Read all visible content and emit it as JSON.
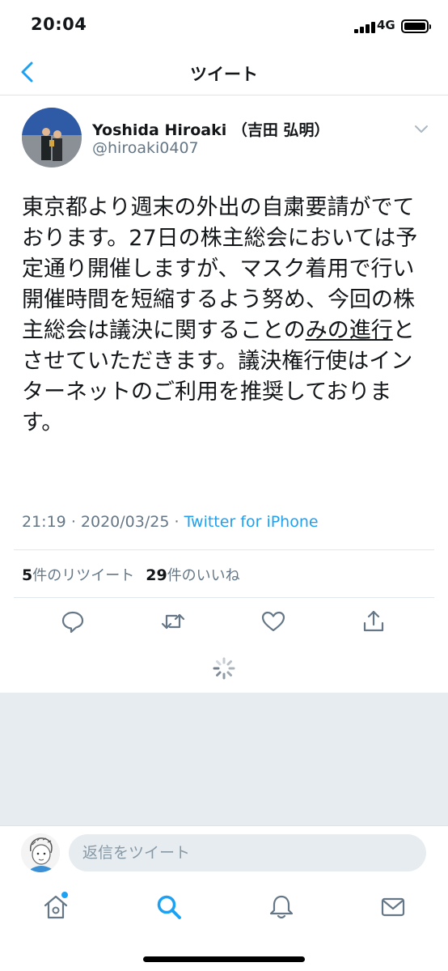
{
  "status_bar": {
    "time": "20:04",
    "network": "4G"
  },
  "nav": {
    "title": "ツイート"
  },
  "tweet": {
    "author_name": "Yoshida Hiroaki （吉田 弘明）",
    "author_handle": "@hiroaki0407",
    "text_before": "東京都より週末の外出の自粛要請がでております。27日の株主総会においては予定通り開催しますが、マスク着用で行い開催時間を短縮するよう努め、今回の株主総会は議決に関することの",
    "text_underlined": "みの進行",
    "text_after": "とさせていただきます。議決権行使はインターネットのご利用を推奨しております。",
    "time": "21:19",
    "separator": "·",
    "date": "2020/03/25",
    "source": "Twitter for iPhone"
  },
  "stats": {
    "retweet_count": "5",
    "retweet_label": "件のリツイート",
    "like_count": "29",
    "like_label": "件のいいね"
  },
  "reply": {
    "placeholder": "返信をツイート"
  },
  "colors": {
    "accent": "#1da1f2",
    "muted": "#657786",
    "divider": "#e1e8ed",
    "gray_bg": "#e6ecf0"
  },
  "icons": {
    "back": "chevron-left-icon",
    "caret": "chevron-down-icon",
    "reply": "comment-icon",
    "retweet": "retweet-icon",
    "like": "heart-icon",
    "share": "share-icon",
    "home": "home-icon",
    "search": "search-icon",
    "notifications": "bell-icon",
    "messages": "envelope-icon"
  }
}
